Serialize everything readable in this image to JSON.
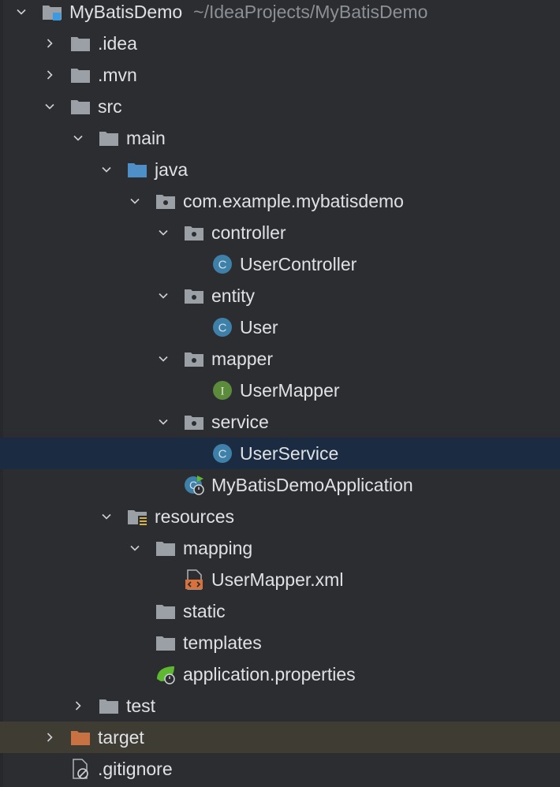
{
  "tree": {
    "root": {
      "label": "MyBatisDemo",
      "path": "~/IdeaProjects/MyBatisDemo"
    },
    "idea": ".idea",
    "mvn": ".mvn",
    "src": "src",
    "main": "main",
    "java": "java",
    "package": "com.example.mybatisdemo",
    "controller": "controller",
    "user_controller": "UserController",
    "entity": "entity",
    "user": "User",
    "mapper": "mapper",
    "user_mapper": "UserMapper",
    "service": "service",
    "user_service": "UserService",
    "application": "MyBatisDemoApplication",
    "resources": "resources",
    "mapping": "mapping",
    "user_mapper_xml": "UserMapper.xml",
    "static": "static",
    "templates": "templates",
    "application_properties": "application.properties",
    "test": "test",
    "target": "target",
    "gitignore": ".gitignore"
  },
  "colors": {
    "background": "#2b2d30",
    "selected_row": "#1b2c42",
    "excluded_row": "#3e3c33",
    "folder": "#9aa0a6",
    "source_folder": "#4e8fc7",
    "excluded_folder": "#c87143",
    "class_icon": "#3f80a8",
    "interface_icon": "#5c8b3c"
  }
}
